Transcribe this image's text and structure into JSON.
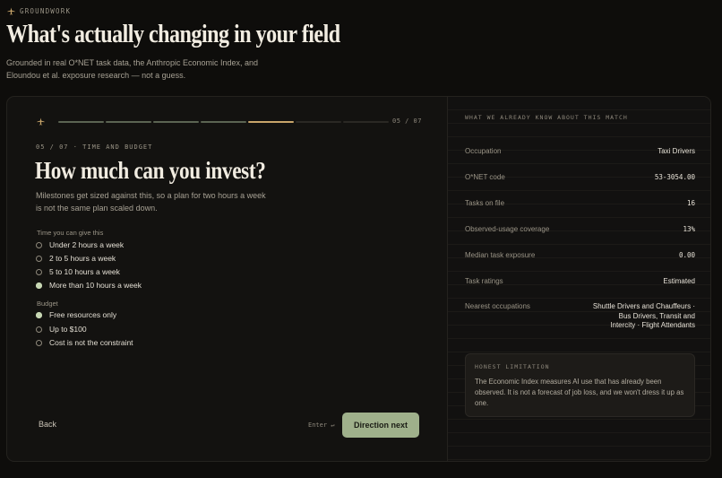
{
  "brand": {
    "name": "GROUNDWORK",
    "icon": "plane-icon"
  },
  "header": {
    "title": "What's actually changing in your field",
    "subtitle": "Grounded in real O*NET task data, the Anthropic Economic Index, and Eloundou et al. exposure research — not a guess."
  },
  "progress": {
    "icon": "plane-icon",
    "count": "05 / 07",
    "current_step": 5,
    "total_steps": 7,
    "colors": {
      "done": "#5b6452",
      "current": "#c8a56a",
      "todo": "#2a2824"
    }
  },
  "step": {
    "kicker": "05 / 07 · TIME AND BUDGET",
    "title": "How much can you invest?",
    "description": "Milestones get sized against this, so a plan for two hours a week is not the same plan scaled down."
  },
  "time_group": {
    "label": "Time you can give this",
    "options": [
      {
        "label": "Under 2 hours a week",
        "selected": false
      },
      {
        "label": "2 to 5 hours a week",
        "selected": false
      },
      {
        "label": "5 to 10 hours a week",
        "selected": false
      },
      {
        "label": "More than 10 hours a week",
        "selected": true
      }
    ]
  },
  "budget_group": {
    "label": "Budget",
    "options": [
      {
        "label": "Free resources only",
        "selected": true
      },
      {
        "label": "Up to $100",
        "selected": false
      },
      {
        "label": "Cost is not the constraint",
        "selected": false
      }
    ]
  },
  "footer": {
    "back_label": "Back",
    "enter_hint": "Enter ↵",
    "next_label": "Direction next"
  },
  "match_panel": {
    "heading": "WHAT WE ALREADY KNOW ABOUT THIS MATCH",
    "rows": [
      {
        "key": "Occupation",
        "value": "Taxi Drivers",
        "mono": false
      },
      {
        "key": "O*NET code",
        "value": "53-3054.00",
        "mono": true
      },
      {
        "key": "Tasks on file",
        "value": "16",
        "mono": true
      },
      {
        "key": "Observed-usage coverage",
        "value": "13%",
        "mono": true
      },
      {
        "key": "Median task exposure",
        "value": "0.00",
        "mono": true
      },
      {
        "key": "Task ratings",
        "value": "Estimated",
        "mono": false
      },
      {
        "key": "Nearest occupations",
        "value_lines": [
          "Shuttle Drivers and Chauffeurs ·",
          "Bus Drivers, Transit and",
          "Intercity · Flight Attendants"
        ],
        "mono": false
      }
    ]
  },
  "limitation": {
    "label": "HONEST LIMITATION",
    "text": "The Economic Index measures AI use that has already been observed. It is not a forecast of job loss, and we won't dress it up as one."
  },
  "colors": {
    "accent": "#9fb08b",
    "gold": "#c8a56a",
    "background": "#0e0d0b"
  }
}
